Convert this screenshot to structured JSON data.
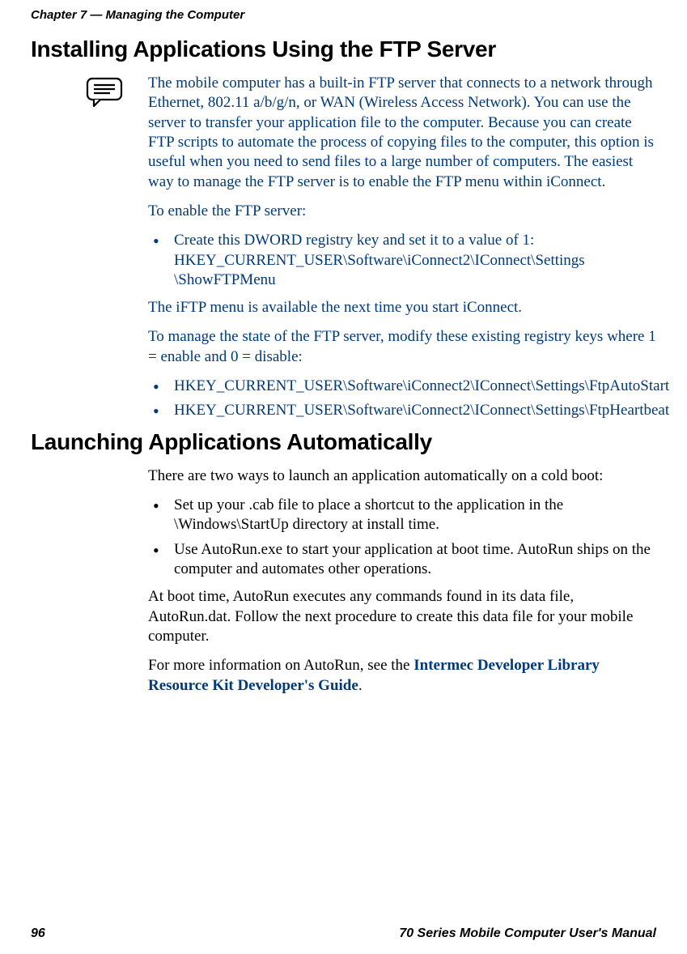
{
  "chapter_header": "Chapter 7 — Managing the Computer",
  "section1": {
    "title": "Installing Applications Using the FTP Server",
    "note": "The mobile computer has a built-in FTP server that connects to a network through Ethernet, 802.11 a/b/g/n, or WAN (Wireless Access Network). You can use the server to transfer your application file to the computer. Because you can create FTP scripts to automate the process of copying files to the computer, this option is useful when you need to send files to a large number of computers. The easiest way to manage the FTP server is to enable the FTP menu within iConnect.",
    "enable_intro": "To enable the FTP server:",
    "bullet1_line1": "Create this DWORD registry key and set it to a value of 1:",
    "bullet1_line2": "HKEY_CURRENT_USER\\Software\\iConnect2\\IConnect\\Settings",
    "bullet1_line3": "\\ShowFTPMenu",
    "iftp_note": "The iFTP menu is available the next time you start iConnect.",
    "manage_intro": "To manage the state of the FTP server, modify these existing registry keys where 1 = enable and 0 = disable:",
    "bullet2": "HKEY_CURRENT_USER\\Software\\iConnect2\\IConnect\\Settings\\FtpAutoStart",
    "bullet3": "HKEY_CURRENT_USER\\Software\\iConnect2\\IConnect\\Settings\\FtpHeartbeat"
  },
  "section2": {
    "title": "Launching Applications Automatically",
    "intro": "There are two ways to launch an application automatically on a cold boot:",
    "bullet1": "Set up your .cab file to place a shortcut to the application in the \\Windows\\StartUp directory at install time.",
    "bullet2": "Use AutoRun.exe to start your application at boot time. AutoRun ships on the computer and automates other operations.",
    "autorun_p": "At boot time, AutoRun executes any commands found in its data file, AutoRun.dat. Follow the next procedure to create this data file for your mobile computer.",
    "more_info_prefix": "For more information on AutoRun, see the ",
    "more_info_link": "Intermec Developer Library Resource Kit Developer's Guide",
    "more_info_suffix": "."
  },
  "footer": {
    "page_number": "96",
    "manual_title": "70 Series Mobile Computer User's Manual"
  }
}
